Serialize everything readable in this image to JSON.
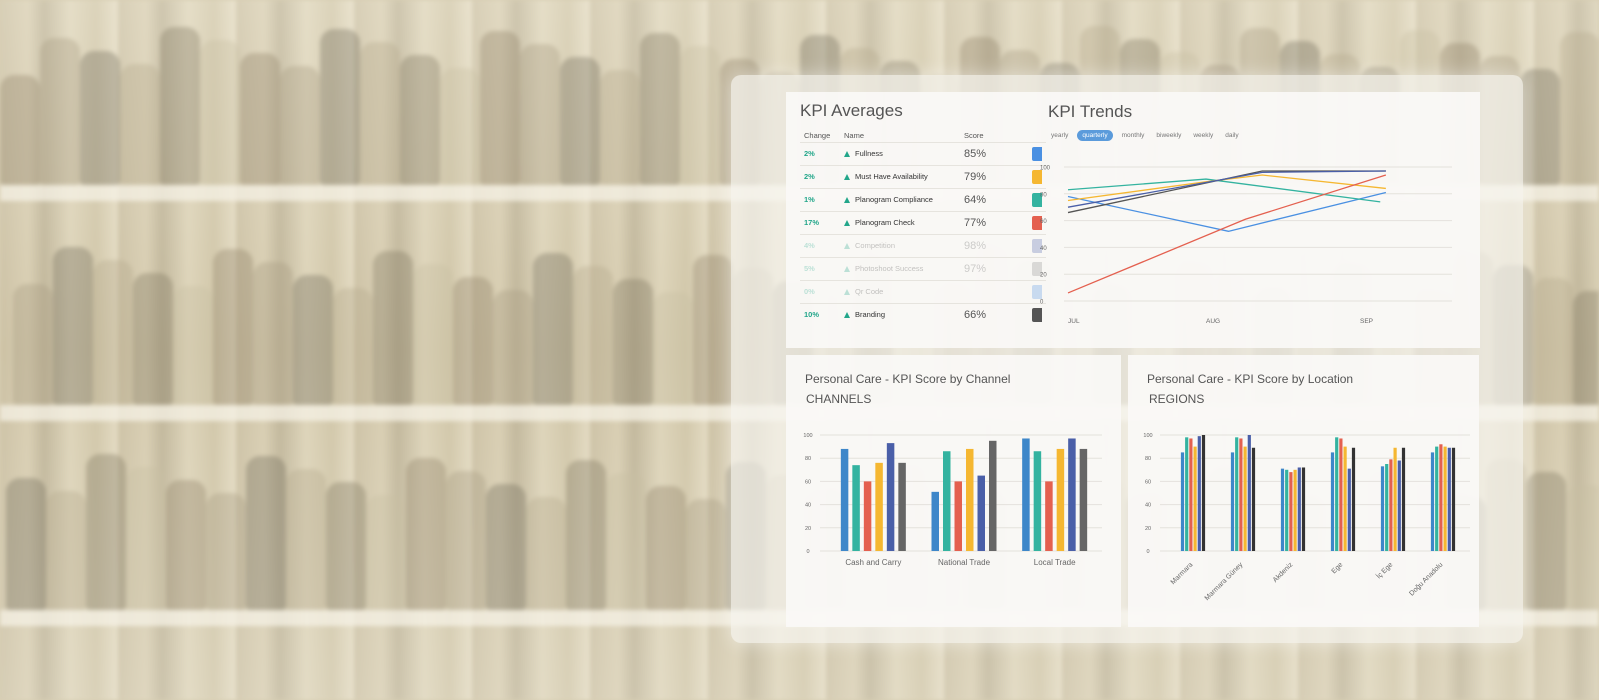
{
  "kpi_averages": {
    "title": "KPI Averages",
    "headers": {
      "change": "Change",
      "name": "Name",
      "score": "Score"
    },
    "rows": [
      {
        "change": "2%",
        "name": "Fullness",
        "score": "85%",
        "color": "#4a90e2",
        "faded": false
      },
      {
        "change": "2%",
        "name": "Must Have Availability",
        "score": "79%",
        "color": "#f5b731",
        "faded": false
      },
      {
        "change": "1%",
        "name": "Planogram Compliance",
        "score": "64%",
        "color": "#34b3a0",
        "faded": false
      },
      {
        "change": "17%",
        "name": "Planogram Check",
        "score": "77%",
        "color": "#e4604f",
        "faded": false
      },
      {
        "change": "4%",
        "name": "Competition",
        "score": "98%",
        "color": "#4a5fa8",
        "faded": true
      },
      {
        "change": "5%",
        "name": "Photoshoot Success",
        "score": "97%",
        "color": "#888888",
        "faded": true
      },
      {
        "change": "0%",
        "name": "Qr Code",
        "score": "",
        "color": "#4a90e2",
        "faded": true
      },
      {
        "change": "10%",
        "name": "Branding",
        "score": "66%",
        "color": "#555555",
        "faded": false
      }
    ]
  },
  "kpi_trends": {
    "title": "KPI Trends",
    "periods": [
      {
        "label": "yearly",
        "active": false
      },
      {
        "label": "quarterly",
        "active": true
      },
      {
        "label": "monthly",
        "active": false
      },
      {
        "label": "biweekly",
        "active": false
      },
      {
        "label": "weekly",
        "active": false
      },
      {
        "label": "daily",
        "active": false
      }
    ]
  },
  "channel_card": {
    "title": "Personal Care - KPI Score by Channel",
    "subtitle": "CHANNELS"
  },
  "location_card": {
    "title": "Personal Care - KPI Score by Location",
    "subtitle": "REGIONS"
  },
  "chart_data": [
    {
      "type": "line",
      "x": [
        "JUL",
        "AUG",
        "SEP"
      ],
      "yticks": [
        "100",
        "80",
        "60",
        "40",
        "20",
        "0"
      ],
      "ylim": [
        0,
        100
      ],
      "series": [
        {
          "color": "#4a90e2",
          "points": [
            [
              0,
              78
            ],
            [
              1.2,
              52
            ],
            [
              2.6,
              81
            ]
          ]
        },
        {
          "color": "#34b3a0",
          "points": [
            [
              0,
              83
            ],
            [
              1.0,
              91
            ],
            [
              2.55,
              74
            ]
          ]
        },
        {
          "color": "#f5b731",
          "points": [
            [
              0,
              75
            ],
            [
              1.0,
              89
            ],
            [
              1.5,
              94
            ],
            [
              2.6,
              84
            ]
          ]
        },
        {
          "color": "#e4604f",
          "points": [
            [
              0,
              6
            ],
            [
              1.35,
              61
            ],
            [
              2.6,
              94
            ]
          ]
        },
        {
          "color": "#555555",
          "points": [
            [
              0,
              66
            ],
            [
              1.5,
              97
            ],
            [
              2.6,
              97
            ]
          ]
        },
        {
          "color": "#4a5fa8",
          "points": [
            [
              0,
              70
            ],
            [
              1.5,
              96
            ],
            [
              2.6,
              97
            ]
          ]
        }
      ]
    },
    {
      "type": "bar",
      "categories": [
        "Cash and Carry",
        "National Trade",
        "Local Trade"
      ],
      "yticks": [
        "100",
        "80",
        "60",
        "40",
        "20",
        "0"
      ],
      "ylim": [
        0,
        100
      ],
      "colors": [
        "#3e87c9",
        "#34b3a0",
        "#e4604f",
        "#f5b731",
        "#4a5fa8",
        "#666666"
      ],
      "series_values": [
        [
          88,
          74,
          60,
          76,
          93,
          76
        ],
        [
          51,
          86,
          60,
          88,
          65,
          95
        ],
        [
          97,
          86,
          60,
          88,
          97,
          88
        ]
      ]
    },
    {
      "type": "bar",
      "categories": [
        "Marmara",
        "Marmara Güney",
        "Akdeniz",
        "Ege",
        "İç Ege",
        "Doğu Anadolu"
      ],
      "yticks": [
        "100",
        "80",
        "60",
        "40",
        "20",
        "0"
      ],
      "ylim": [
        0,
        100
      ],
      "colors": [
        "#3e87c9",
        "#34b3a0",
        "#e4604f",
        "#f5b731",
        "#4a5fa8",
        "#333333"
      ],
      "series_values": [
        [
          85,
          98,
          97,
          90,
          99,
          100
        ],
        [
          85,
          98,
          97,
          90,
          100,
          89
        ],
        [
          71,
          70,
          68,
          70,
          72,
          72
        ],
        [
          85,
          98,
          97,
          90,
          71,
          89
        ],
        [
          73,
          75,
          79,
          89,
          78,
          89
        ],
        [
          85,
          90,
          92,
          90,
          89,
          89
        ]
      ]
    }
  ]
}
